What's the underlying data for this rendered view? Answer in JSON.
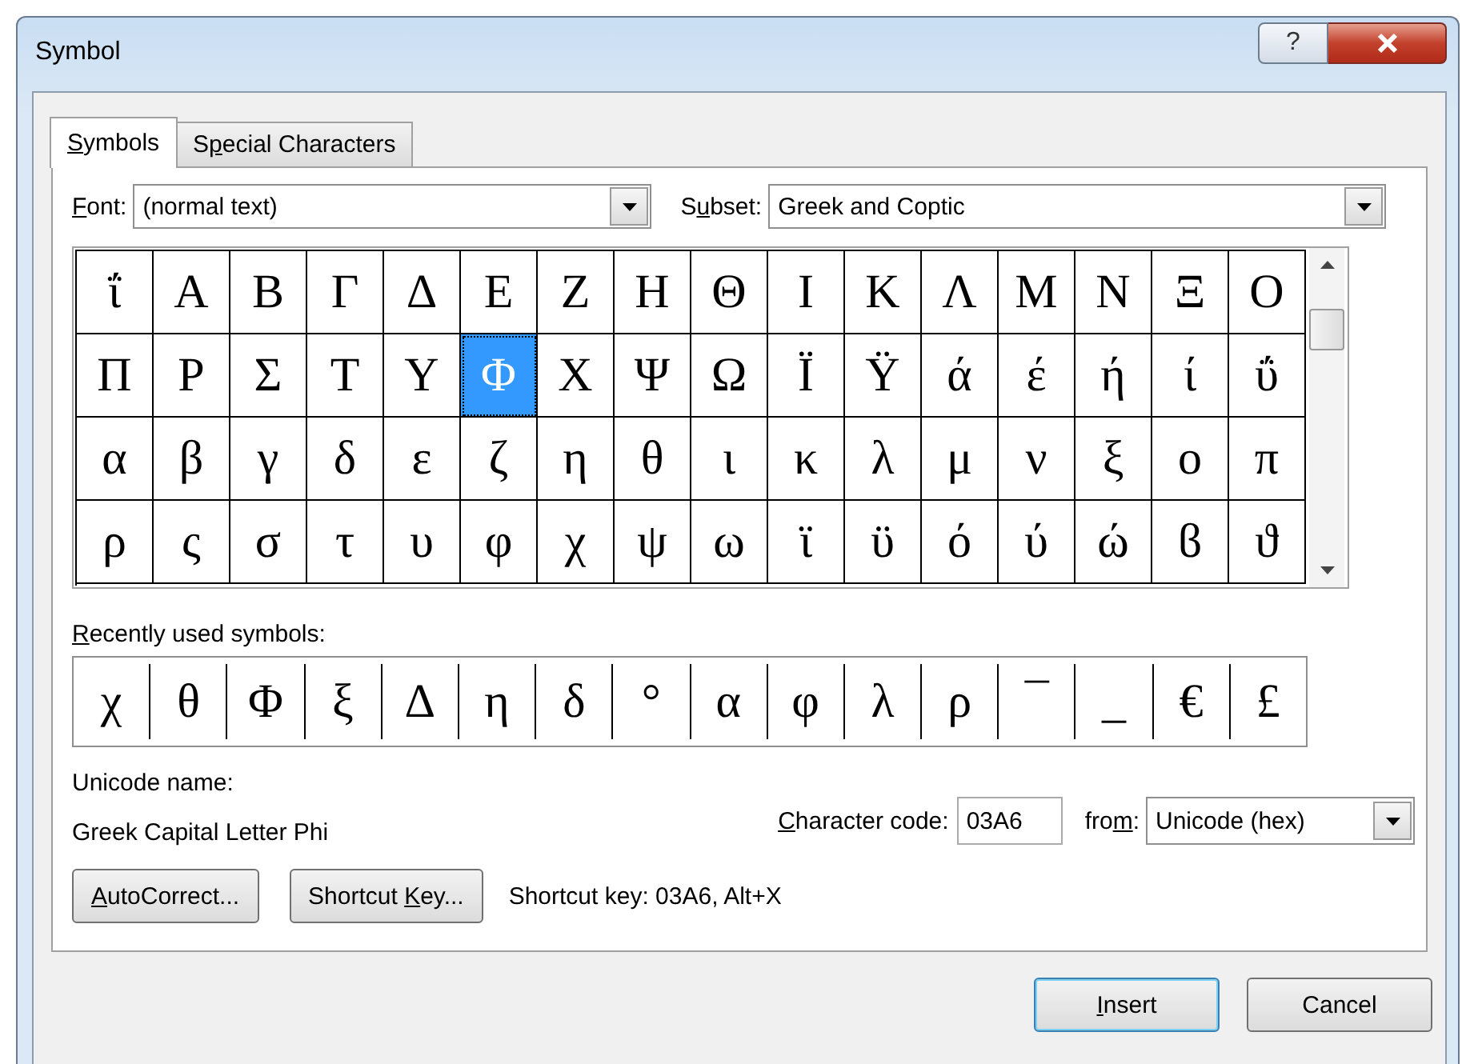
{
  "window": {
    "title": "Symbol",
    "help": "?"
  },
  "tabs": [
    {
      "label": {
        "key": "S",
        "post": "ymbols"
      },
      "selected": true
    },
    {
      "label": {
        "pre": "S",
        "key": "p",
        "post": "ecial Characters"
      },
      "selected": false
    }
  ],
  "font": {
    "label": {
      "key": "F",
      "post": "ont:"
    },
    "value": "(normal text)"
  },
  "subset": {
    "label": {
      "pre": "S",
      "key": "u",
      "post": "bset:"
    },
    "value": "Greek and Coptic"
  },
  "symbols": [
    {
      "char": "ΐ",
      "selected": false
    },
    {
      "char": "Α",
      "selected": false
    },
    {
      "char": "Β",
      "selected": false
    },
    {
      "char": "Γ",
      "selected": false
    },
    {
      "char": "Δ",
      "selected": false
    },
    {
      "char": "Ε",
      "selected": false
    },
    {
      "char": "Ζ",
      "selected": false
    },
    {
      "char": "Η",
      "selected": false
    },
    {
      "char": "Θ",
      "selected": false
    },
    {
      "char": "Ι",
      "selected": false
    },
    {
      "char": "Κ",
      "selected": false
    },
    {
      "char": "Λ",
      "selected": false
    },
    {
      "char": "Μ",
      "selected": false
    },
    {
      "char": "Ν",
      "selected": false
    },
    {
      "char": "Ξ",
      "selected": false
    },
    {
      "char": "Ο",
      "selected": false
    },
    {
      "char": "Π",
      "selected": false
    },
    {
      "char": "Ρ",
      "selected": false
    },
    {
      "char": "Σ",
      "selected": false
    },
    {
      "char": "Τ",
      "selected": false
    },
    {
      "char": "Υ",
      "selected": false
    },
    {
      "char": "Φ",
      "selected": true
    },
    {
      "char": "Χ",
      "selected": false
    },
    {
      "char": "Ψ",
      "selected": false
    },
    {
      "char": "Ω",
      "selected": false
    },
    {
      "char": "Ϊ",
      "selected": false
    },
    {
      "char": "Ϋ",
      "selected": false
    },
    {
      "char": "ά",
      "selected": false
    },
    {
      "char": "έ",
      "selected": false
    },
    {
      "char": "ή",
      "selected": false
    },
    {
      "char": "ί",
      "selected": false
    },
    {
      "char": "ΰ",
      "selected": false
    },
    {
      "char": "α",
      "selected": false
    },
    {
      "char": "β",
      "selected": false
    },
    {
      "char": "γ",
      "selected": false
    },
    {
      "char": "δ",
      "selected": false
    },
    {
      "char": "ε",
      "selected": false
    },
    {
      "char": "ζ",
      "selected": false
    },
    {
      "char": "η",
      "selected": false
    },
    {
      "char": "θ",
      "selected": false
    },
    {
      "char": "ι",
      "selected": false
    },
    {
      "char": "κ",
      "selected": false
    },
    {
      "char": "λ",
      "selected": false
    },
    {
      "char": "μ",
      "selected": false
    },
    {
      "char": "ν",
      "selected": false
    },
    {
      "char": "ξ",
      "selected": false
    },
    {
      "char": "ο",
      "selected": false
    },
    {
      "char": "π",
      "selected": false
    },
    {
      "char": "ρ",
      "selected": false
    },
    {
      "char": "ς",
      "selected": false
    },
    {
      "char": "σ",
      "selected": false
    },
    {
      "char": "τ",
      "selected": false
    },
    {
      "char": "υ",
      "selected": false
    },
    {
      "char": "φ",
      "selected": false
    },
    {
      "char": "χ",
      "selected": false
    },
    {
      "char": "ψ",
      "selected": false
    },
    {
      "char": "ω",
      "selected": false
    },
    {
      "char": "ϊ",
      "selected": false
    },
    {
      "char": "ϋ",
      "selected": false
    },
    {
      "char": "ό",
      "selected": false
    },
    {
      "char": "ύ",
      "selected": false
    },
    {
      "char": "ώ",
      "selected": false
    },
    {
      "char": "ϐ",
      "selected": false
    },
    {
      "char": "ϑ",
      "selected": false
    }
  ],
  "recent": {
    "label": {
      "key": "R",
      "post": "ecently used symbols:"
    },
    "symbols": [
      "χ",
      "θ",
      "Φ",
      "ξ",
      "Δ",
      "η",
      "δ",
      "°",
      "α",
      "φ",
      "λ",
      "ρ",
      "¯",
      "_",
      "€",
      "£"
    ]
  },
  "unicode_name": {
    "label": "Unicode name:",
    "value": "Greek Capital Letter Phi"
  },
  "character_code": {
    "label": {
      "key": "C",
      "post": "haracter code:"
    },
    "value": "03A6"
  },
  "from": {
    "label": {
      "pre": "fro",
      "key": "m",
      "post": ":"
    },
    "value": "Unicode (hex)"
  },
  "buttons": [
    {
      "label": {
        "key": "A",
        "post": "utoCorrect..."
      }
    },
    {
      "label": {
        "pre": "Shortcut ",
        "key": "K",
        "post": "ey..."
      }
    }
  ],
  "shortcut_text": "Shortcut key: 03A6, Alt+X",
  "footer_buttons": [
    {
      "label": {
        "key": "I",
        "post": "nsert"
      },
      "default": true
    },
    {
      "label": {
        "post": "Cancel"
      },
      "default": false
    }
  ]
}
